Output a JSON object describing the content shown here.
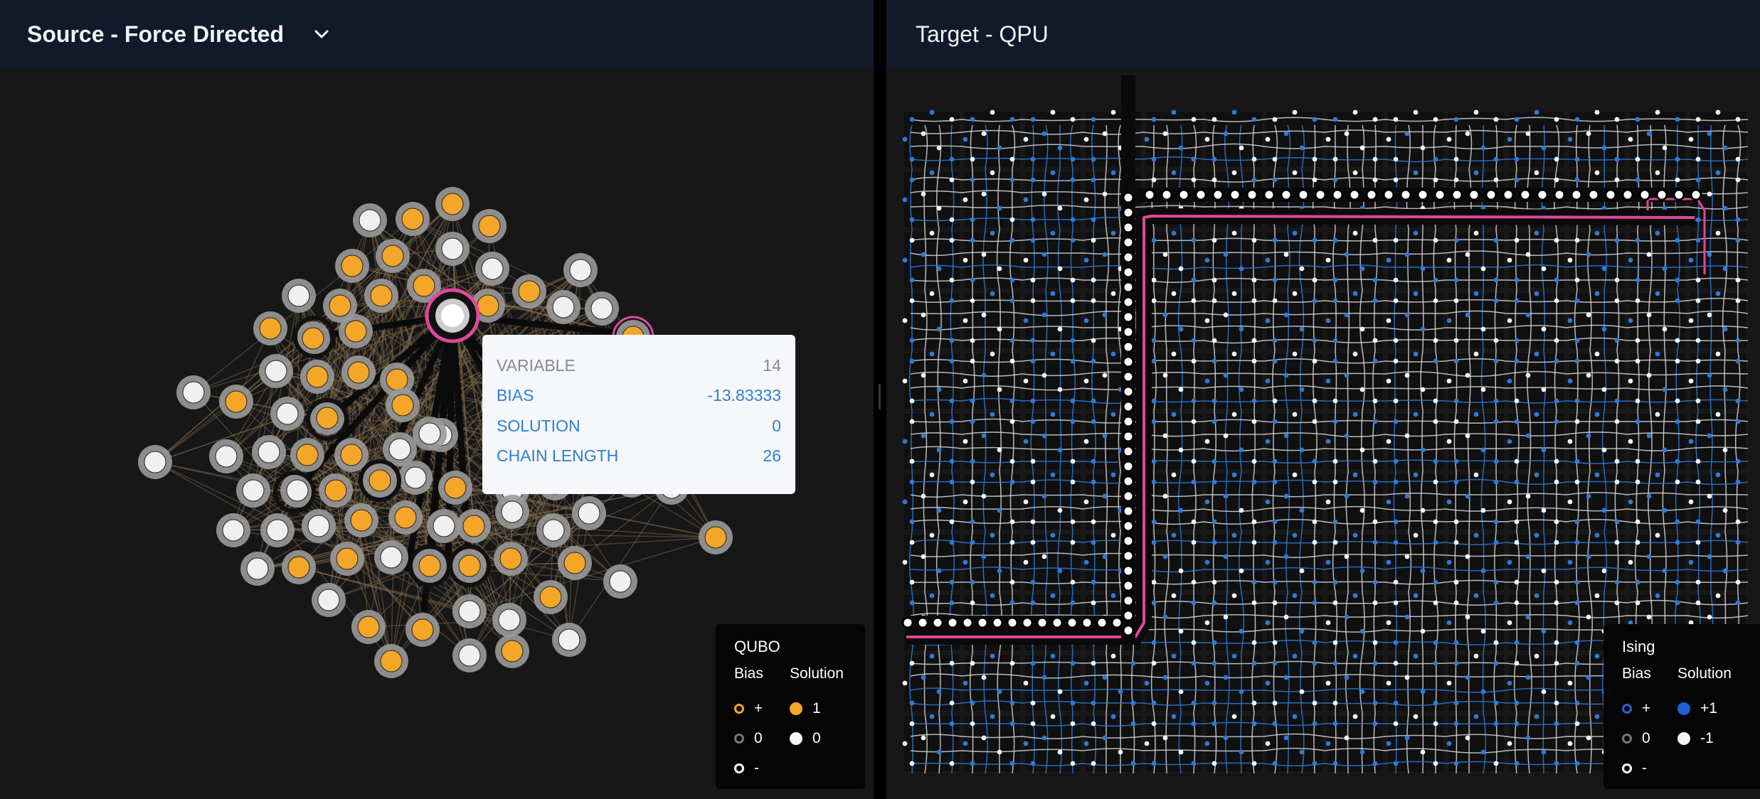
{
  "source": {
    "title": "Source - Force Directed",
    "dropdown_icon": "chevron-down-icon",
    "tooltip": {
      "variable_label": "VARIABLE",
      "variable_value": "14",
      "bias_label": "BIAS",
      "bias_value": "-13.83333",
      "solution_label": "SOLUTION",
      "solution_value": "0",
      "chain_label": "CHAIN LENGTH",
      "chain_value": "26"
    },
    "legend": {
      "title": "QUBO",
      "bias_header": "Bias",
      "solution_header": "Solution",
      "bias_items": [
        "+",
        "0",
        "-"
      ],
      "solution_items": [
        "1",
        "0"
      ]
    },
    "colors": {
      "orange": "#f4a629",
      "white": "#f0f0f0",
      "selected": "#e0489a"
    }
  },
  "target": {
    "title": "Target - QPU",
    "legend": {
      "title": "Ising",
      "bias_header": "Bias",
      "solution_header": "Solution",
      "bias_items": [
        "+",
        "0",
        "-"
      ],
      "solution_items": [
        "+1",
        "-1"
      ]
    },
    "colors": {
      "blue": "#1f5fd0",
      "chain": "#e0489a",
      "grid": "#d8d8d8"
    }
  }
}
